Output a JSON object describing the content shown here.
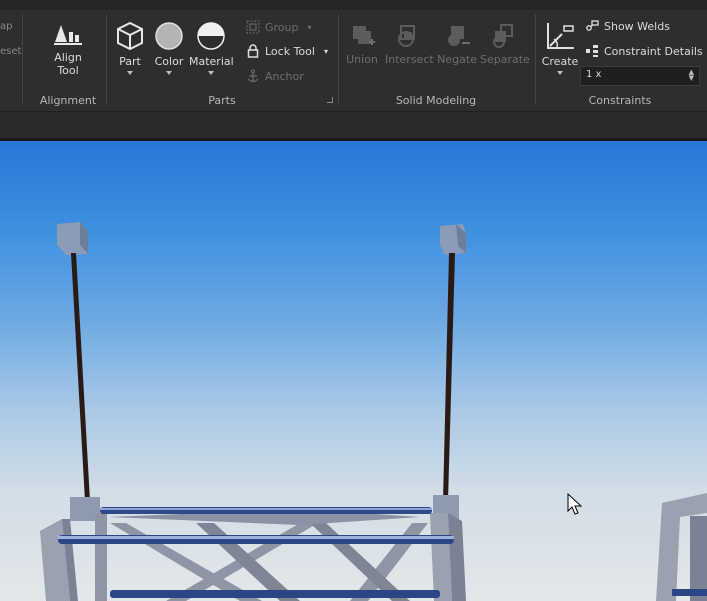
{
  "ribbon": {
    "cut_left": {
      "top": "ap",
      "bottom": "eset"
    },
    "alignment": {
      "button_label_1": "Align",
      "button_label_2": "Tool",
      "group_title": "Alignment"
    },
    "parts": {
      "part_label": "Part",
      "color_label": "Color",
      "material_label": "Material",
      "group_label": "Group",
      "lock_tool_label": "Lock Tool",
      "anchor_label": "Anchor",
      "group_title": "Parts"
    },
    "solid_modeling": {
      "union_label": "Union",
      "intersect_label": "Intersect",
      "negate_label": "Negate",
      "separate_label": "Separate",
      "group_title": "Solid Modeling"
    },
    "constraints": {
      "create_label": "Create",
      "show_welds_label": "Show Welds",
      "constraint_details_label": "Constraint Details",
      "scale_value": "1 x",
      "group_title": "Constraints"
    }
  },
  "colors": {
    "ribbon_bg": "#2e2e2e",
    "sky_top": "#2a77d8",
    "sky_bottom": "#e4e7ea"
  }
}
